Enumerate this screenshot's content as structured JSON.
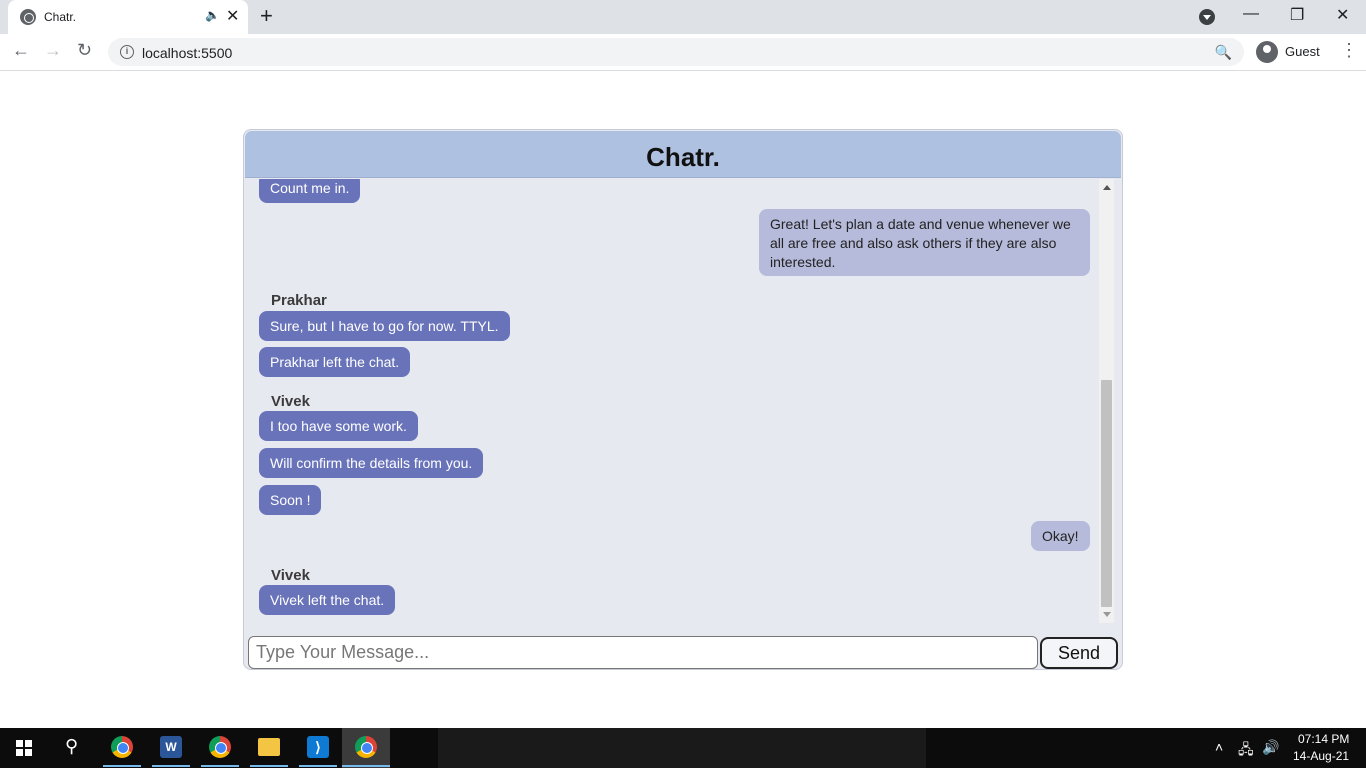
{
  "browser": {
    "tab_title": "Chatr.",
    "url": "localhost:5500",
    "profile": "Guest"
  },
  "chat": {
    "title": "Chatr.",
    "input_placeholder": "Type Your Message...",
    "send_label": "Send",
    "messages": [
      {
        "direction": "in",
        "text": "Count me in."
      },
      {
        "direction": "out",
        "text": "Great! Let's plan a date and venue whenever we all are free and also ask others if they are also interested."
      },
      {
        "direction": "in",
        "sender": "Prakhar",
        "text": "Sure, but I have to go for now. TTYL."
      },
      {
        "direction": "in",
        "text": "Prakhar left the chat."
      },
      {
        "direction": "in",
        "sender": "Vivek",
        "text": "I too have some work."
      },
      {
        "direction": "in",
        "text": "Will confirm the details from you."
      },
      {
        "direction": "in",
        "text": "Soon !"
      },
      {
        "direction": "out",
        "text": "Okay!"
      },
      {
        "direction": "in",
        "sender": "Vivek",
        "text": "Vivek left the chat."
      }
    ]
  },
  "taskbar": {
    "time": "07:14 PM",
    "date": "14-Aug-21"
  },
  "colors": {
    "header": "#afc1e1",
    "incoming_bubble": "#6973ba",
    "outgoing_bubble": "#b7bbdb",
    "chat_background": "#e7e9f0"
  }
}
